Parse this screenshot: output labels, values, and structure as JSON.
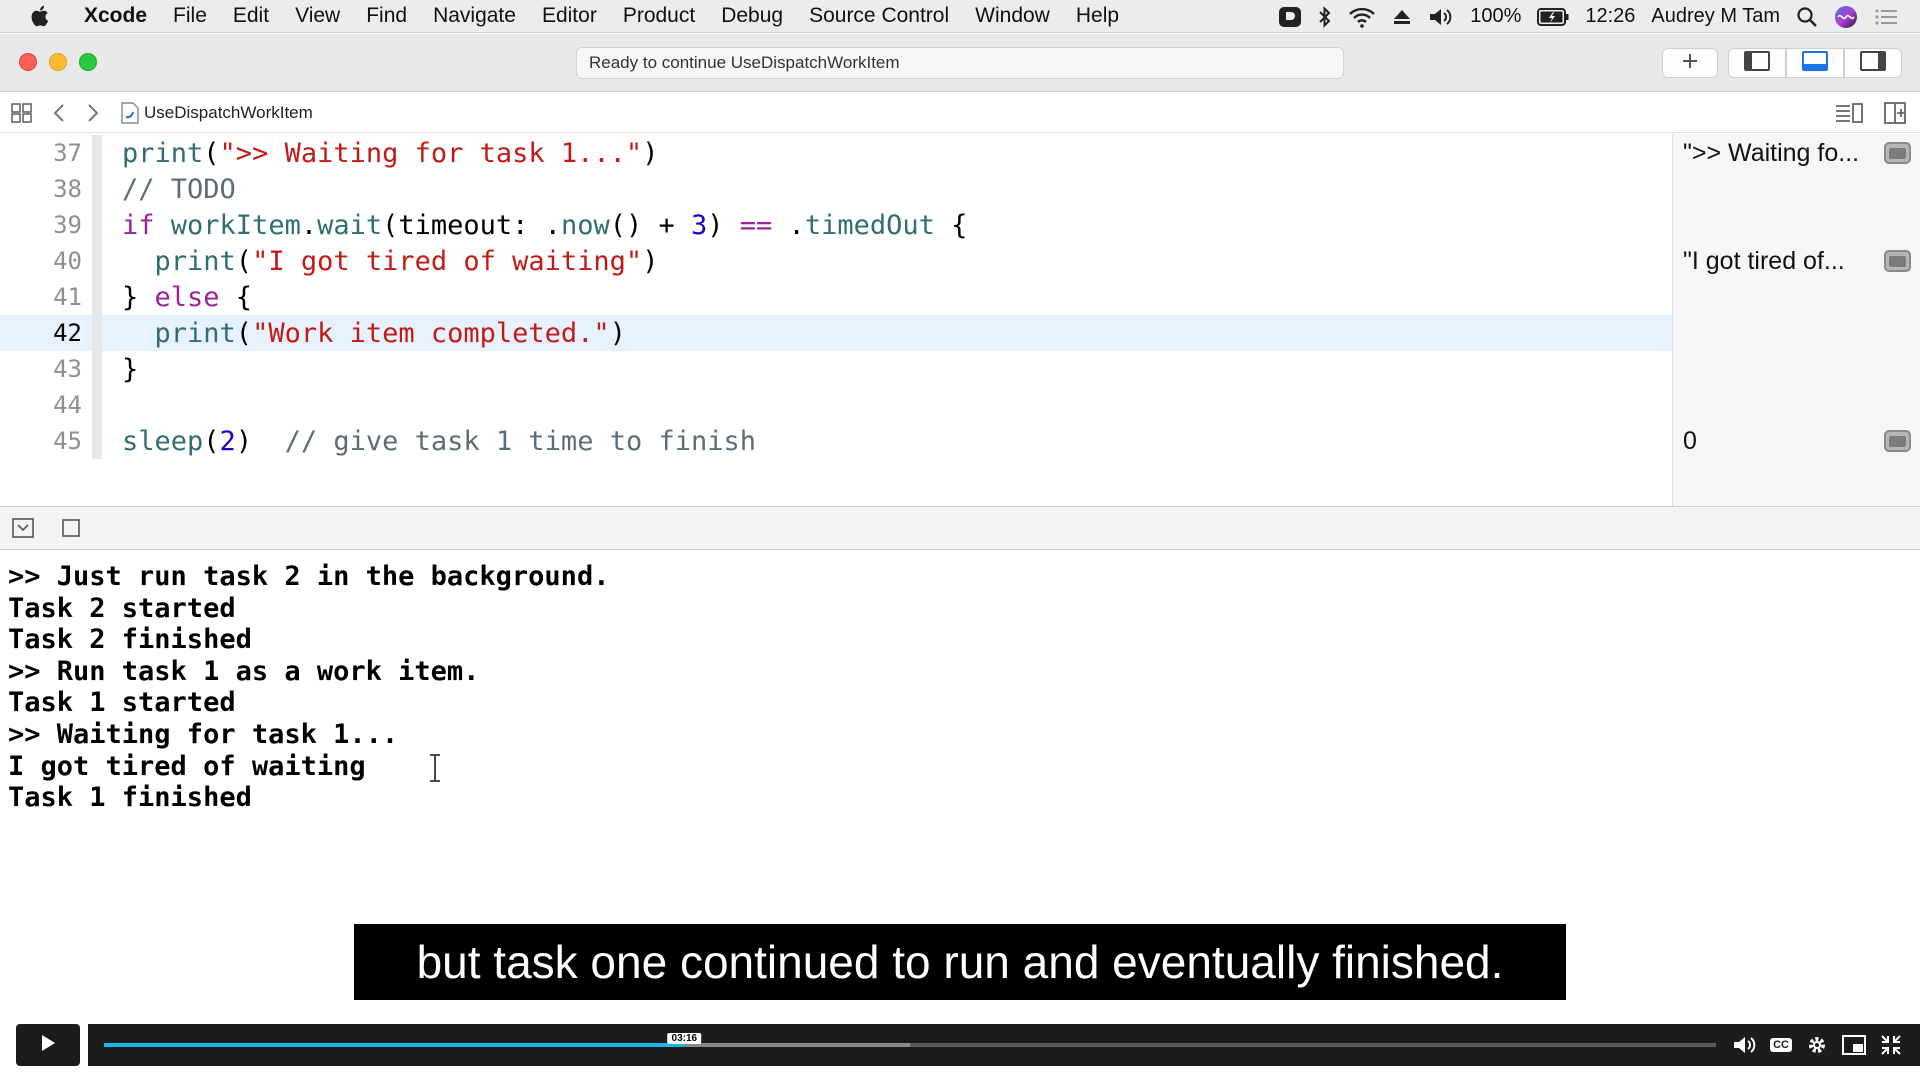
{
  "menubar": {
    "app_name": "Xcode",
    "items": [
      "File",
      "Edit",
      "View",
      "Find",
      "Navigate",
      "Editor",
      "Product",
      "Debug",
      "Source Control",
      "Window",
      "Help"
    ],
    "battery": "100%",
    "time": "12:26",
    "user": "Audrey M Tam"
  },
  "toolbar": {
    "activity_status": "Ready to continue UseDispatchWorkItem"
  },
  "jumpbar": {
    "filename": "UseDispatchWorkItem"
  },
  "editor": {
    "lines": [
      {
        "number": "37",
        "tokens": [
          [
            "fn",
            "print"
          ],
          [
            "p",
            "("
          ],
          [
            "str",
            "\">> Waiting for task 1...\""
          ],
          [
            "p",
            ")"
          ]
        ]
      },
      {
        "number": "38",
        "tokens": [
          [
            "cm",
            "// TODO"
          ]
        ]
      },
      {
        "number": "39",
        "tokens": [
          [
            "kw",
            "if"
          ],
          [
            "p",
            " "
          ],
          [
            "fn",
            "workItem"
          ],
          [
            "p",
            "."
          ],
          [
            "fn",
            "wait"
          ],
          [
            "p",
            "(timeout: ."
          ],
          [
            "fn",
            "now"
          ],
          [
            "p",
            "() + "
          ],
          [
            "num",
            "3"
          ],
          [
            "p",
            ") "
          ],
          [
            "kw",
            "=="
          ],
          [
            "p",
            " ."
          ],
          [
            "fn",
            "timedOut"
          ],
          [
            "p",
            " {"
          ]
        ]
      },
      {
        "number": "40",
        "tokens": [
          [
            "p",
            "  "
          ],
          [
            "fn",
            "print"
          ],
          [
            "p",
            "("
          ],
          [
            "str",
            "\"I got tired of waiting\""
          ],
          [
            "p",
            ")"
          ]
        ]
      },
      {
        "number": "41",
        "tokens": [
          [
            "p",
            "} "
          ],
          [
            "kw",
            "else"
          ],
          [
            "p",
            " {"
          ]
        ]
      },
      {
        "number": "42",
        "current": true,
        "tokens": [
          [
            "p",
            "  "
          ],
          [
            "fn",
            "print"
          ],
          [
            "p",
            "("
          ],
          [
            "str",
            "\"Work item completed.\""
          ],
          [
            "p",
            ")"
          ]
        ]
      },
      {
        "number": "43",
        "tokens": [
          [
            "p",
            "}"
          ]
        ]
      },
      {
        "number": "44",
        "tokens": []
      },
      {
        "number": "45",
        "tokens": [
          [
            "fn",
            "sleep"
          ],
          [
            "p",
            "("
          ],
          [
            "num",
            "2"
          ],
          [
            "p",
            ")  "
          ],
          [
            "cm",
            "// give task 1 time to finish"
          ]
        ]
      }
    ]
  },
  "results": [
    {
      "line_index": 0,
      "text": "\">> Waiting fo..."
    },
    {
      "line_index": 3,
      "text": "\"I got tired of..."
    },
    {
      "line_index": 8,
      "text": "0"
    }
  ],
  "console": {
    "lines": [
      ">> Just run task 2 in the background.",
      "Task 2 started",
      "Task 2 finished",
      ">> Run task 1 as a work item.",
      "Task 1 started",
      ">> Waiting for task 1...",
      "I got tired of waiting",
      "Task 1 finished"
    ]
  },
  "caption": {
    "text": "but task one continued to run and eventually finished."
  },
  "player": {
    "time_tooltip": "03:16",
    "progress": 0.36,
    "buffered": 0.5,
    "cc_label": "CC"
  },
  "colors": {
    "keyword": "#9b2393",
    "string": "#c41a16",
    "function": "#326d74",
    "number": "#1c00cf",
    "comment": "#5d6c79",
    "current_line": "#e8f2ff",
    "progress": "#1ab7ea"
  }
}
